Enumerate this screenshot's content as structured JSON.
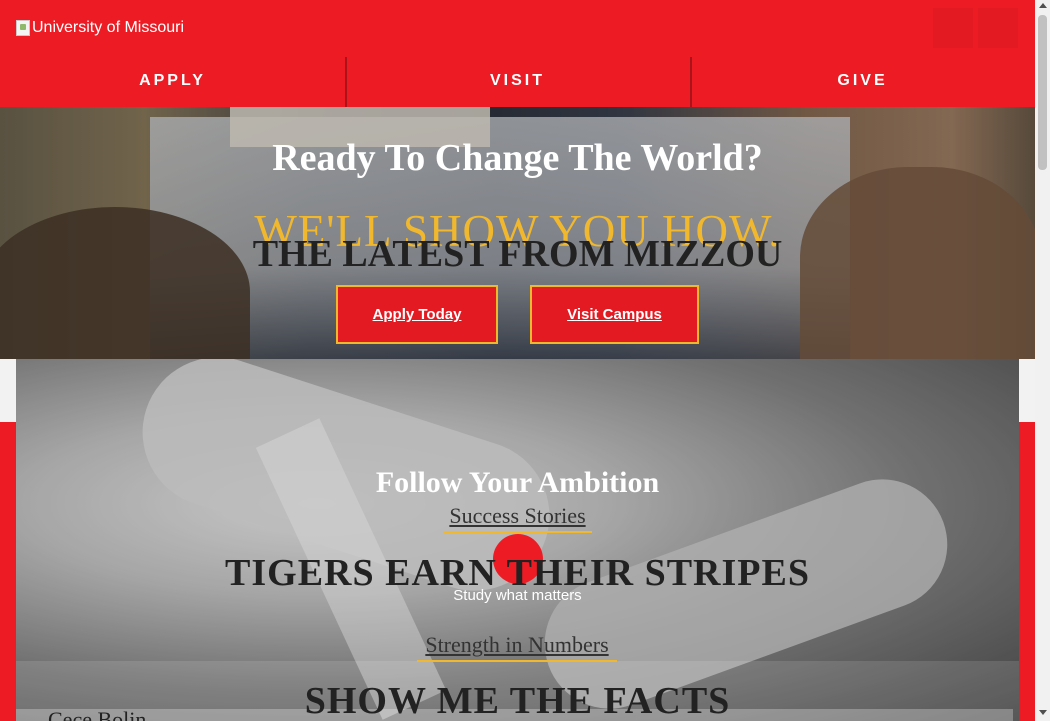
{
  "header": {
    "logo_alt": "University of Missouri",
    "search_icon": "search-icon",
    "menu_icon": "menu-icon"
  },
  "nav": {
    "items": [
      {
        "label": "APPLY"
      },
      {
        "label": "VISIT"
      },
      {
        "label": "GIVE"
      }
    ]
  },
  "hero": {
    "title": "Ready To Change The World?",
    "tagline": "WE'LL SHOW YOU HOW.",
    "apply_button": "Apply Today",
    "visit_button": "Visit Campus"
  },
  "news": {
    "heading": "THE LATEST FROM MIZZOU"
  },
  "ambition": {
    "title": "Follow Your Ambition",
    "subheading": "Success Stories",
    "play_icon": "play-icon",
    "headline": "TIGERS EARN THEIR STRIPES",
    "caption": "Study what matters"
  },
  "facts": {
    "subheading": "Strength in Numbers",
    "headline": "SHOW ME THE FACTS",
    "name": "Cece Bolin"
  },
  "colors": {
    "brand_red": "#ED1C24",
    "brand_gold": "#F1B82D",
    "text_dark": "#222222",
    "white": "#FFFFFF"
  }
}
